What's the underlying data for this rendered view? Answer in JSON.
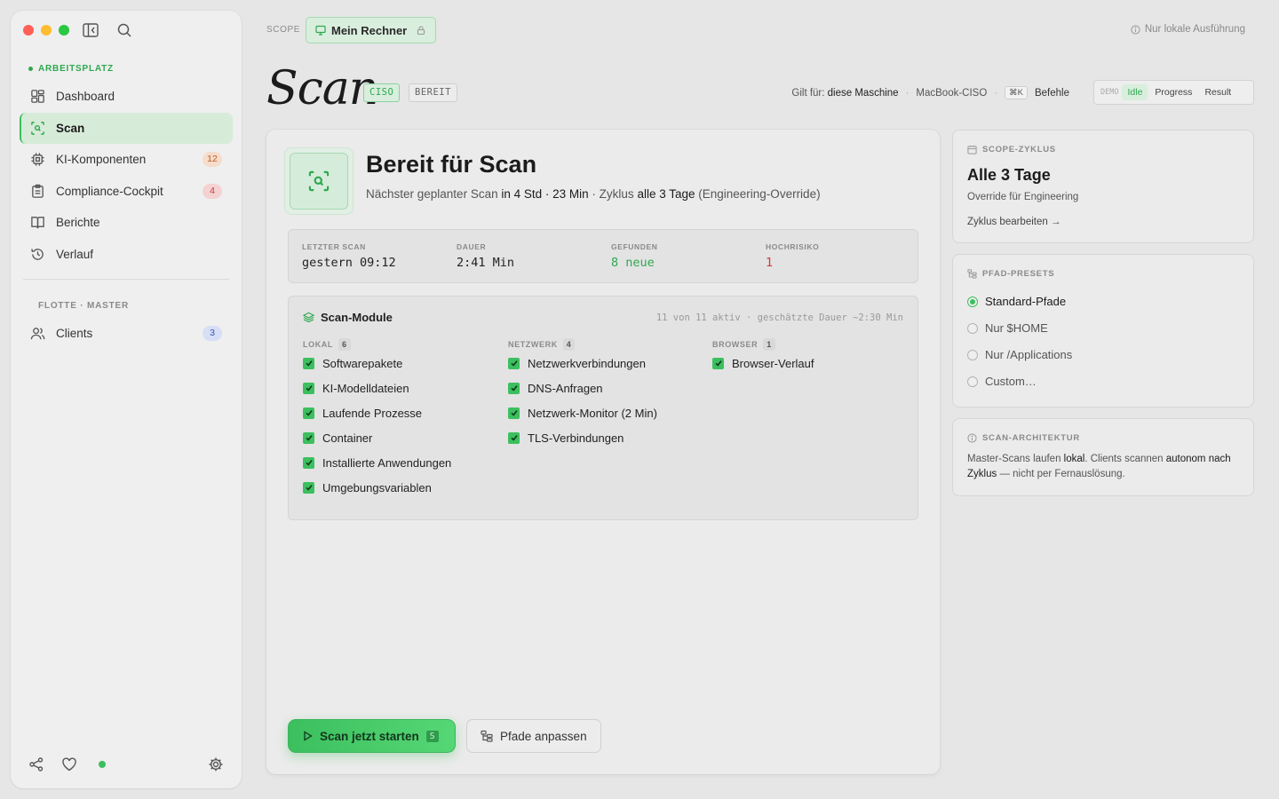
{
  "sidebar": {
    "workspace_label": "ARBEITSPLATZ",
    "items": [
      {
        "label": "Dashboard"
      },
      {
        "label": "Scan"
      },
      {
        "label": "KI-Komponenten",
        "badge": "12"
      },
      {
        "label": "Compliance-Cockpit",
        "badge": "4"
      },
      {
        "label": "Berichte"
      },
      {
        "label": "Verlauf"
      }
    ],
    "fleet_label": "FLOTTE · MASTER",
    "fleet_items": [
      {
        "label": "Clients",
        "badge": "3"
      }
    ]
  },
  "topbar": {
    "scope_label": "SCOPE",
    "scope_value": "Mein Rechner",
    "local_only": "Nur lokale Ausführung"
  },
  "header": {
    "title": "Scan",
    "tag_ciso": "CISO",
    "tag_ready": "BEREIT",
    "applies_prefix": "Gilt für:",
    "applies_value": "diese Maschine",
    "machine": "MacBook-CISO",
    "shortcut": "⌘K",
    "commands": "Befehle",
    "demo_label": "DEMO",
    "demo_modes": [
      "Idle",
      "Progress",
      "Result"
    ],
    "demo_active": "Idle"
  },
  "main": {
    "hero_title": "Bereit für Scan",
    "hero_sub_1": "Nächster geplanter Scan",
    "hero_sub_2": "in 4 Std · 23 Min",
    "hero_sub_3": "· Zyklus",
    "hero_sub_4": "alle 3 Tage",
    "hero_sub_5": "(Engineering-Override)",
    "stats": [
      {
        "label": "LETZTER SCAN",
        "value": "gestern 09:12"
      },
      {
        "label": "DAUER",
        "value": "2:41 Min"
      },
      {
        "label": "GEFUNDEN",
        "value": "8 neue"
      },
      {
        "label": "HOCHRISIKO",
        "value": "1"
      }
    ],
    "modules": {
      "title": "Scan-Module",
      "summary": "11 von 11 aktiv · geschätzte Dauer ~2:30 Min",
      "columns": [
        {
          "head": "LOKAL",
          "count": "6",
          "items": [
            "Softwarepakete",
            "KI-Modelldateien",
            "Laufende Prozesse",
            "Container",
            "Installierte Anwendungen",
            "Umgebungsvariablen"
          ]
        },
        {
          "head": "NETZWERK",
          "count": "4",
          "items": [
            "Netzwerkverbindungen",
            "DNS-Anfragen",
            "Netzwerk-Monitor (2 Min)",
            "TLS-Verbindungen"
          ]
        },
        {
          "head": "BROWSER",
          "count": "1",
          "items": [
            "Browser-Verlauf"
          ]
        }
      ]
    },
    "start_button": "Scan jetzt starten",
    "start_key": "S",
    "paths_button": "Pfade anpassen"
  },
  "panels": {
    "cycle": {
      "label": "SCOPE-ZYKLUS",
      "title": "Alle 3 Tage",
      "sub": "Override für Engineering",
      "link": "Zyklus bearbeiten →"
    },
    "presets": {
      "label": "PFAD-PRESETS",
      "options": [
        "Standard-Pfade",
        "Nur $HOME",
        "Nur /Applications",
        "Custom…"
      ],
      "selected": "Standard-Pfade"
    },
    "arch": {
      "label": "SCAN-ARCHITEKTUR",
      "t1": "Master-Scans laufen",
      "t2": "lokal",
      "t3": ". Clients scannen",
      "t4": "autonom nach Zyklus",
      "t5": "— nicht per Fernauslösung."
    }
  },
  "colors": {
    "accent": "#3cbf5e",
    "accent_soft": "#d9eedd",
    "danger": "#d23b3b"
  }
}
